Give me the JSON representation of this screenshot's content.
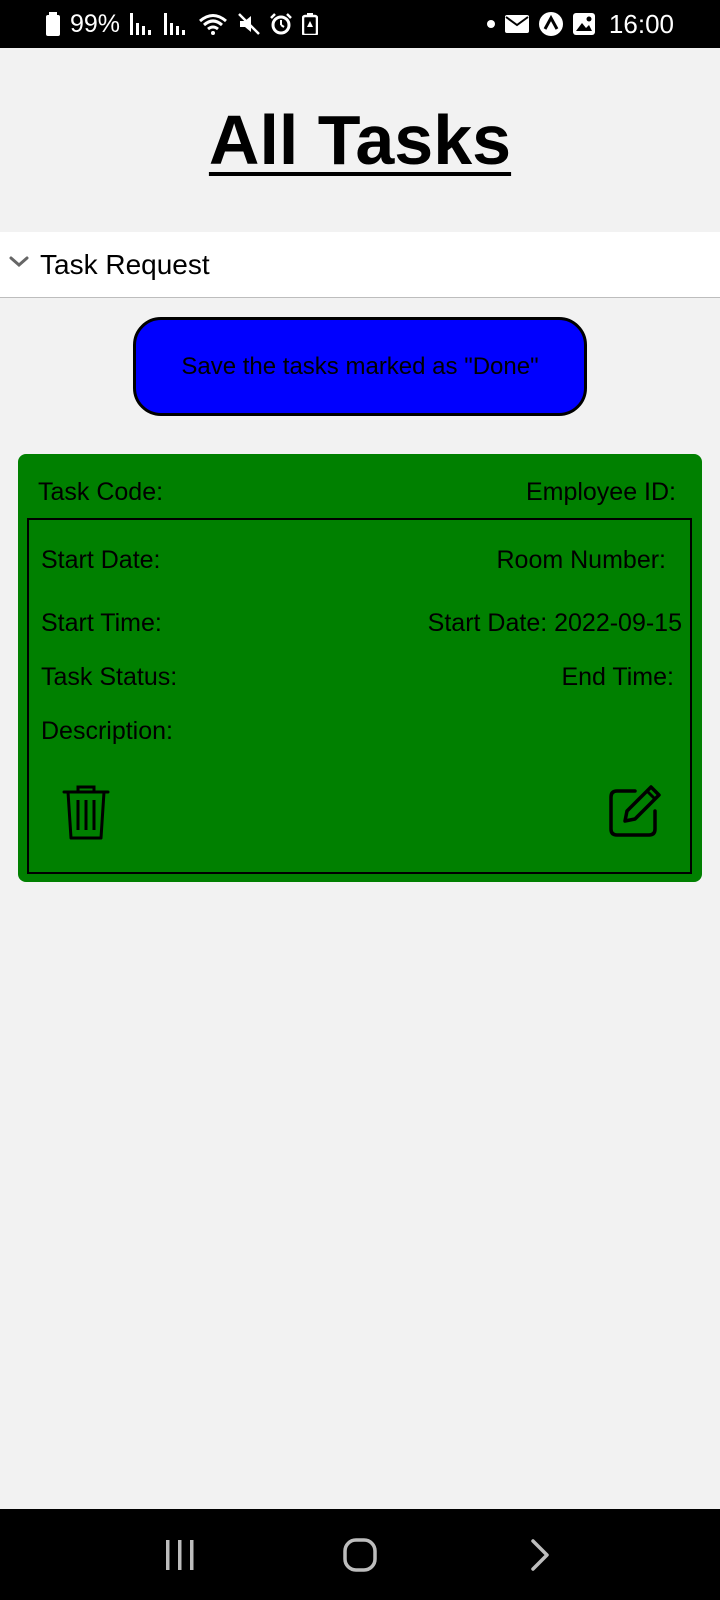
{
  "status_bar": {
    "battery": "99%",
    "time": "16:00",
    "icons_left": [
      "battery-icon",
      "signal-icon",
      "signal-icon",
      "wifi-icon",
      "mute-icon",
      "alarm-icon",
      "battery-saver-icon"
    ],
    "icons_right": [
      "notification-dot",
      "mail-icon",
      "app-icon",
      "gallery-icon"
    ]
  },
  "page": {
    "title": "All Tasks"
  },
  "accordion": {
    "label": "Task Request",
    "icon": "chevron-down-icon"
  },
  "save_button": {
    "label": "Save the tasks marked as \"Done\""
  },
  "task_card": {
    "task_code_label": "Task Code:",
    "employee_id_label": "Employee ID:",
    "start_date_label": "Start Date:",
    "room_number_label": "Room Number:",
    "start_time_label": "Start Time:",
    "start_date_value_label": "Start Date: 2022-09-15",
    "task_status_label": "Task Status:",
    "end_time_label": "End Time:",
    "description_label": "Description:",
    "delete_icon": "trash-icon",
    "edit_icon": "edit-icon"
  },
  "colors": {
    "save_button_bg": "#0000ff",
    "card_bg": "#008000",
    "page_bg": "#f2f2f2"
  },
  "nav_bar": {
    "buttons": [
      "recent-apps-icon",
      "home-icon",
      "back-icon"
    ]
  }
}
